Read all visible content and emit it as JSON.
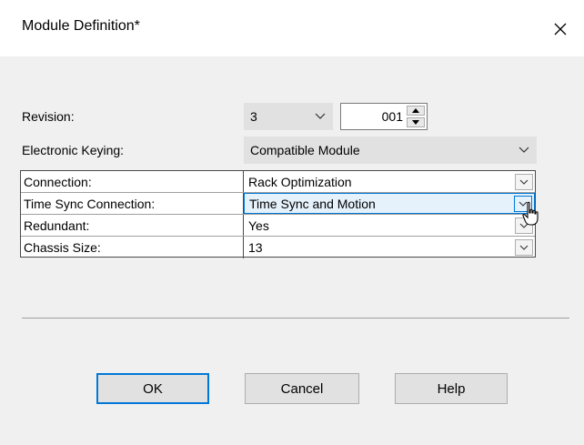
{
  "dialog": {
    "title": "Module Definition*"
  },
  "revision": {
    "label": "Revision:",
    "major_value": "3",
    "minor_value": "001"
  },
  "electronic_keying": {
    "label": "Electronic Keying:",
    "value": "Compatible Module"
  },
  "properties": [
    {
      "name": "Connection:",
      "value": "Rack Optimization"
    },
    {
      "name": "Time Sync Connection:",
      "value": "Time Sync and Motion"
    },
    {
      "name": "Redundant:",
      "value": "Yes"
    },
    {
      "name": "Chassis Size:",
      "value": "13"
    }
  ],
  "buttons": {
    "ok": "OK",
    "cancel": "Cancel",
    "help": "Help"
  },
  "icons": {
    "close": "close-icon",
    "chevron": "chevron-down-icon",
    "spinner_up": "spinner-up-icon",
    "spinner_down": "spinner-down-icon",
    "cursor": "hand-pointer-icon"
  },
  "colors": {
    "accent": "#0078d7",
    "dialog_bg": "#f0f0f0",
    "combo_bg": "#e1e1e1",
    "highlight_bg": "#e5f1fb"
  }
}
